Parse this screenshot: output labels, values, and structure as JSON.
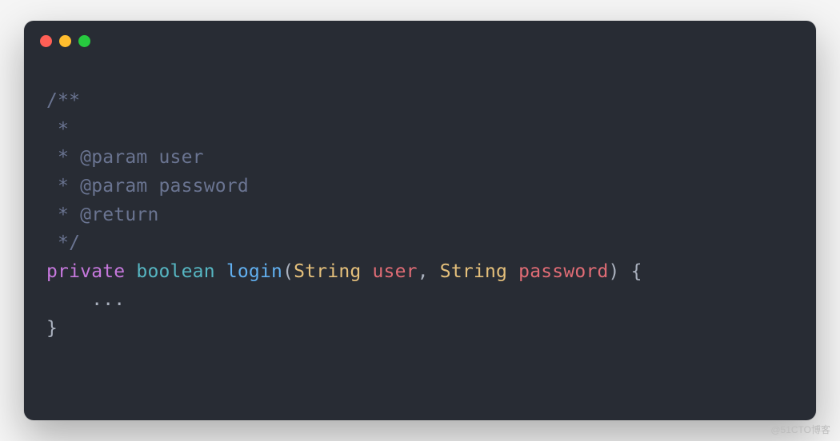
{
  "titlebar": {
    "close_color": "#ff5f56",
    "minimize_color": "#ffbd2e",
    "zoom_color": "#27c93f"
  },
  "code": {
    "comment_open": "/**",
    "comment_star": " *",
    "comment_param1_prefix": " * ",
    "comment_param1_tag": "@param",
    "comment_param1_name": " user",
    "comment_param2_prefix": " * ",
    "comment_param2_tag": "@param",
    "comment_param2_name": " password",
    "comment_return_prefix": " * ",
    "comment_return_tag": "@return",
    "comment_close": " */",
    "kw_private": "private",
    "kw_boolean": "boolean",
    "method_name": "login",
    "paren_open": "(",
    "type_string1": "String",
    "param_user": "user",
    "comma_space": ", ",
    "type_string2": "String",
    "param_password": "password",
    "paren_close": ")",
    "brace_open": " {",
    "body_indent": "    ",
    "body_ellipsis": "...",
    "brace_close": "}",
    "space": " "
  },
  "watermark": "@51CTO博客"
}
